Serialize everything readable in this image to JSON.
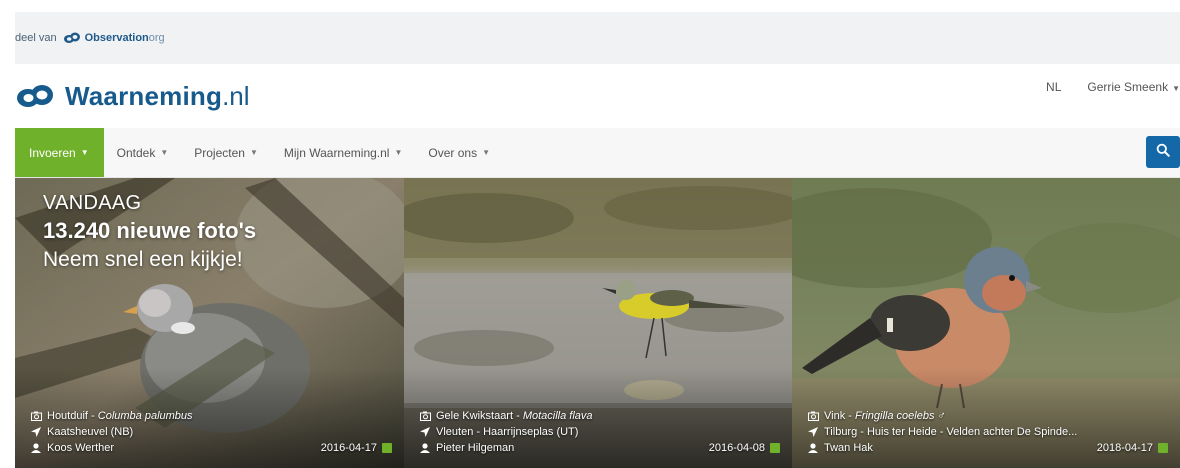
{
  "partner": {
    "prefix": "deel van",
    "name": "Observation",
    "tld": "org"
  },
  "header": {
    "brand_name": "Waarneming",
    "brand_tld": ".nl",
    "language": "NL",
    "user": "Gerrie Smeenk"
  },
  "nav": {
    "items": [
      {
        "label": "Invoeren"
      },
      {
        "label": "Ontdek"
      },
      {
        "label": "Projecten"
      },
      {
        "label": "Mijn Waarneming.nl"
      },
      {
        "label": "Over ons"
      }
    ],
    "search_icon": "search-icon"
  },
  "promo": {
    "line1": "VANDAAG",
    "line2": "13.240 nieuwe foto's",
    "line3": "Neem snel een kijkje!"
  },
  "photos": [
    {
      "species": "Houtduif",
      "scientific": "Columba palumbus",
      "location": "Kaatsheuvel (NB)",
      "observer": "Koos Werther",
      "date": "2016-04-17"
    },
    {
      "species": "Gele Kwikstaart",
      "scientific": "Motacilla flava",
      "location": "Vleuten - Haarrijnseplas (UT)",
      "observer": "Pieter Hilgeman",
      "date": "2016-04-08"
    },
    {
      "species": "Vink",
      "scientific": "Fringilla coelebs ♂",
      "location": "Tilburg - Huis ter Heide - Velden achter De Spinde...",
      "observer": "Twan Hak",
      "date": "2018-04-17"
    }
  ],
  "colors": {
    "brand": "#175a8c",
    "nav_active": "#6fb12b",
    "search_button": "#1568a8",
    "partner_bar": "#f0f2f4"
  }
}
